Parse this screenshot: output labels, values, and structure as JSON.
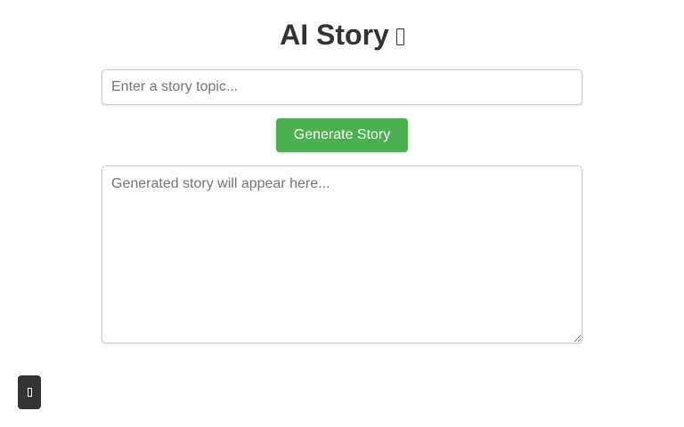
{
  "header": {
    "title": "AI Story",
    "title_icon": "missing-glyph-icon"
  },
  "topic": {
    "placeholder": "Enter a story topic...",
    "value": ""
  },
  "generate_button": {
    "label": "Generate Story",
    "color": "#4caf50"
  },
  "story": {
    "placeholder": "Generated story will appear here...",
    "value": ""
  },
  "theme_toggle": {
    "icon": "missing-glyph-icon",
    "color": "#333333"
  }
}
